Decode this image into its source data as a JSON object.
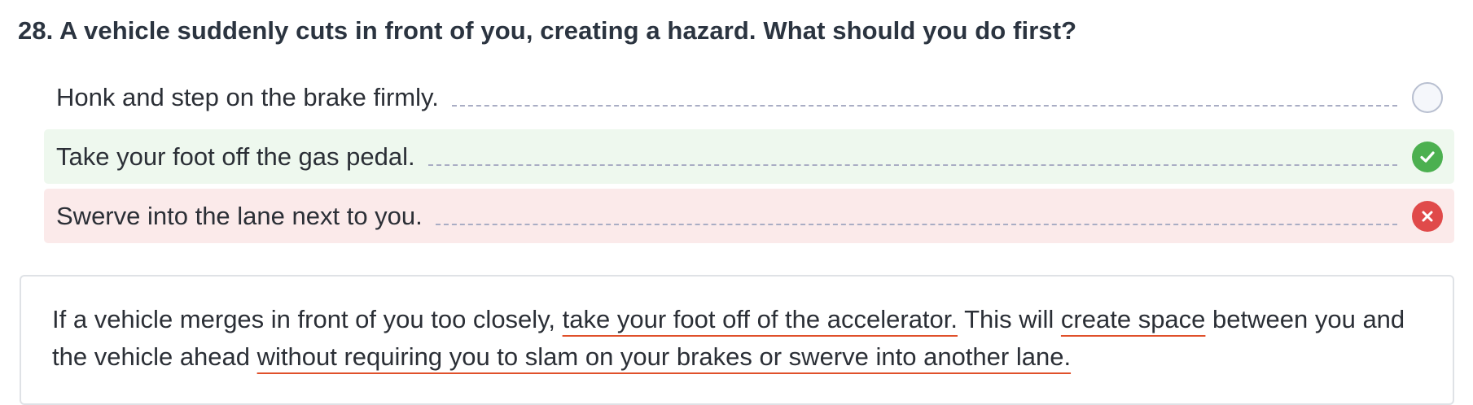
{
  "question": {
    "text": "28. A vehicle suddenly cuts in front of you, creating a hazard. What should you do first?"
  },
  "answers": [
    {
      "label": "Honk and step on the brake firmly.",
      "state": "unselected",
      "icon": "empty-radio-icon"
    },
    {
      "label": "Take your foot off the gas pedal.",
      "state": "correct",
      "icon": "check-circle-icon"
    },
    {
      "label": "Swerve into the lane next to you.",
      "state": "incorrect",
      "icon": "x-circle-icon"
    }
  ],
  "explanation": {
    "t1": "If a vehicle merges in front of you too closely, ",
    "h1": "take your foot off of the accelerator.",
    "t2": " This will ",
    "h2": "create space",
    "t3": " between you and the vehicle ahead ",
    "h3": "without requiring you to slam on your brakes or swerve into another lane."
  },
  "colors": {
    "correct_bg": "#eef8ee",
    "incorrect_bg": "#fbeaea",
    "check": "#4cb050",
    "cross": "#e04a4a",
    "underline": "#e0502a"
  }
}
